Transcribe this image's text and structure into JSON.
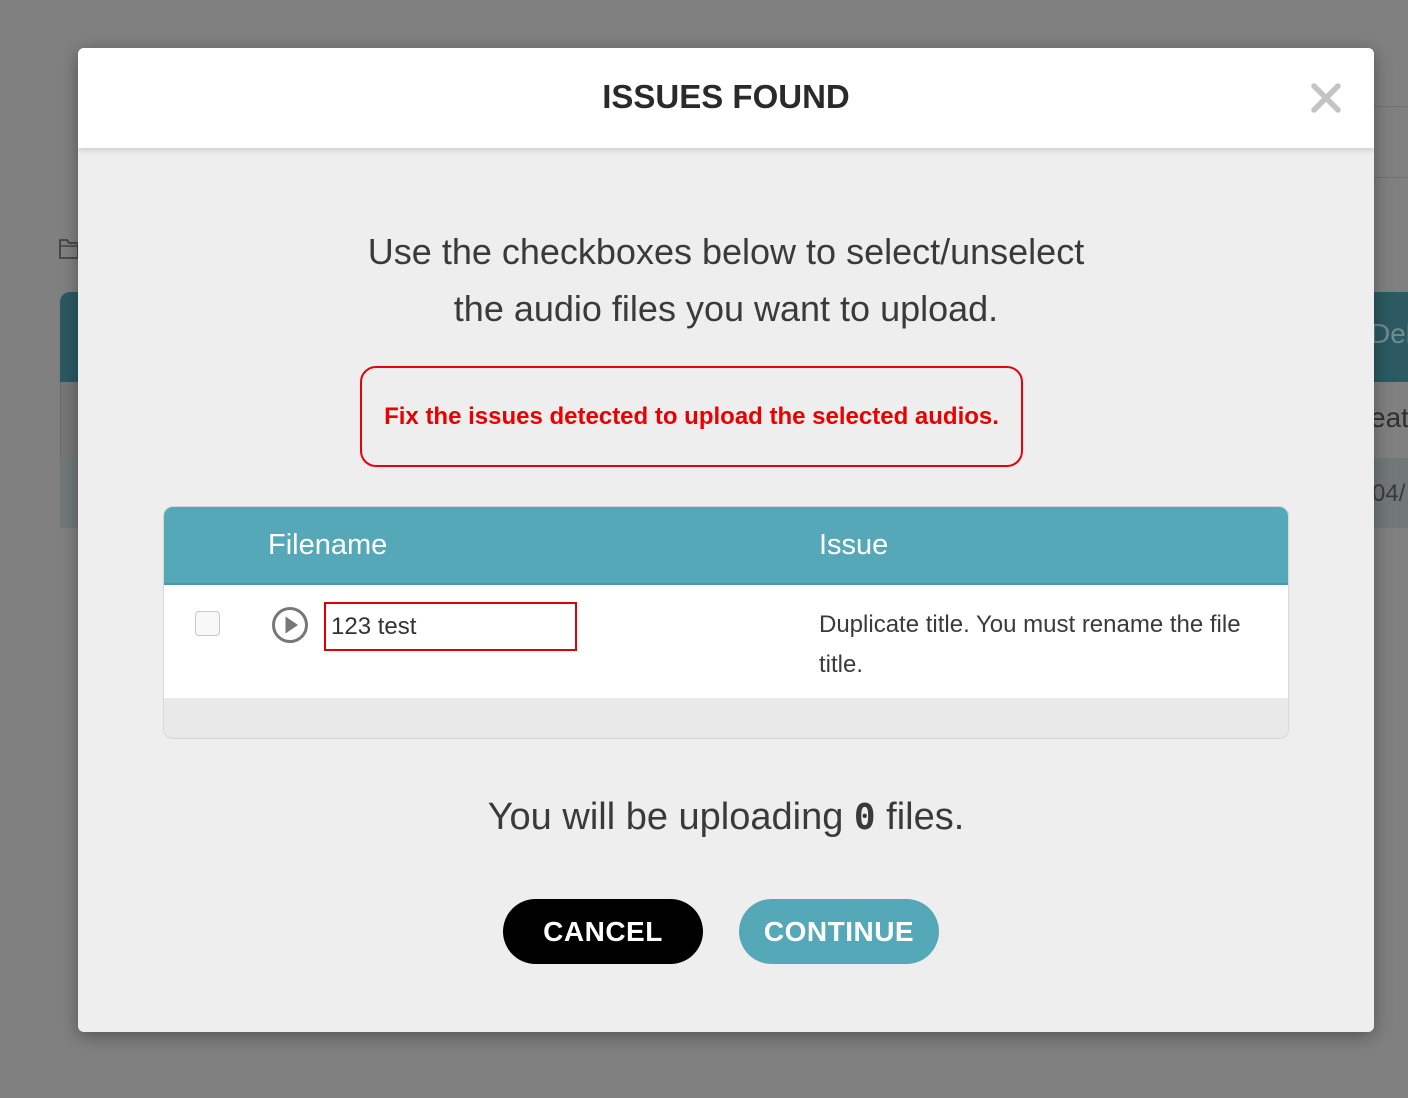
{
  "background": {
    "header_fragment": "Del",
    "row_fragment": "eat",
    "row2_fragment": "04/"
  },
  "modal": {
    "title": "ISSUES FOUND",
    "instructions_line1": "Use the checkboxes below to select/unselect",
    "instructions_line2": "the audio files you want to upload.",
    "error_message": "Fix the issues detected to upload the selected audios.",
    "table": {
      "headers": {
        "filename": "Filename",
        "issue": "Issue"
      },
      "rows": [
        {
          "checked": false,
          "filename": "123 test",
          "issue": "Duplicate title. You must rename the file title."
        }
      ]
    },
    "summary_prefix": "You will be uploading",
    "summary_count": "0",
    "summary_suffix": "files.",
    "cancel_label": "CANCEL",
    "continue_label": "CONTINUE"
  },
  "colors": {
    "accent": "#55a8b8",
    "error": "#ea0000",
    "cancel": "#000000"
  },
  "icons": {
    "close": "close-icon",
    "play": "play-circle-icon",
    "folder": "folder-icon"
  }
}
